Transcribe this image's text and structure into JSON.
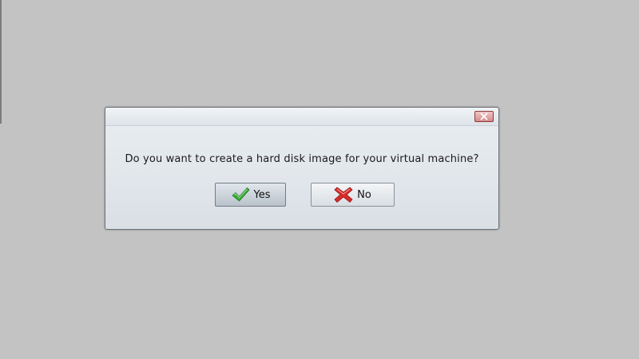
{
  "dialog": {
    "message": "Do you want to create a hard disk image for your virtual machine?",
    "close_icon": "close-icon",
    "buttons": {
      "yes": {
        "label": "Yes",
        "icon": "checkmark-icon",
        "color": "#3aa835"
      },
      "no": {
        "label": "No",
        "icon": "red-x-icon",
        "color": "#d92b2b"
      }
    }
  },
  "colors": {
    "desktop_background": "#c3c3c3",
    "dialog_background": "#e4e9ee",
    "close_button": "#d48b8b"
  }
}
